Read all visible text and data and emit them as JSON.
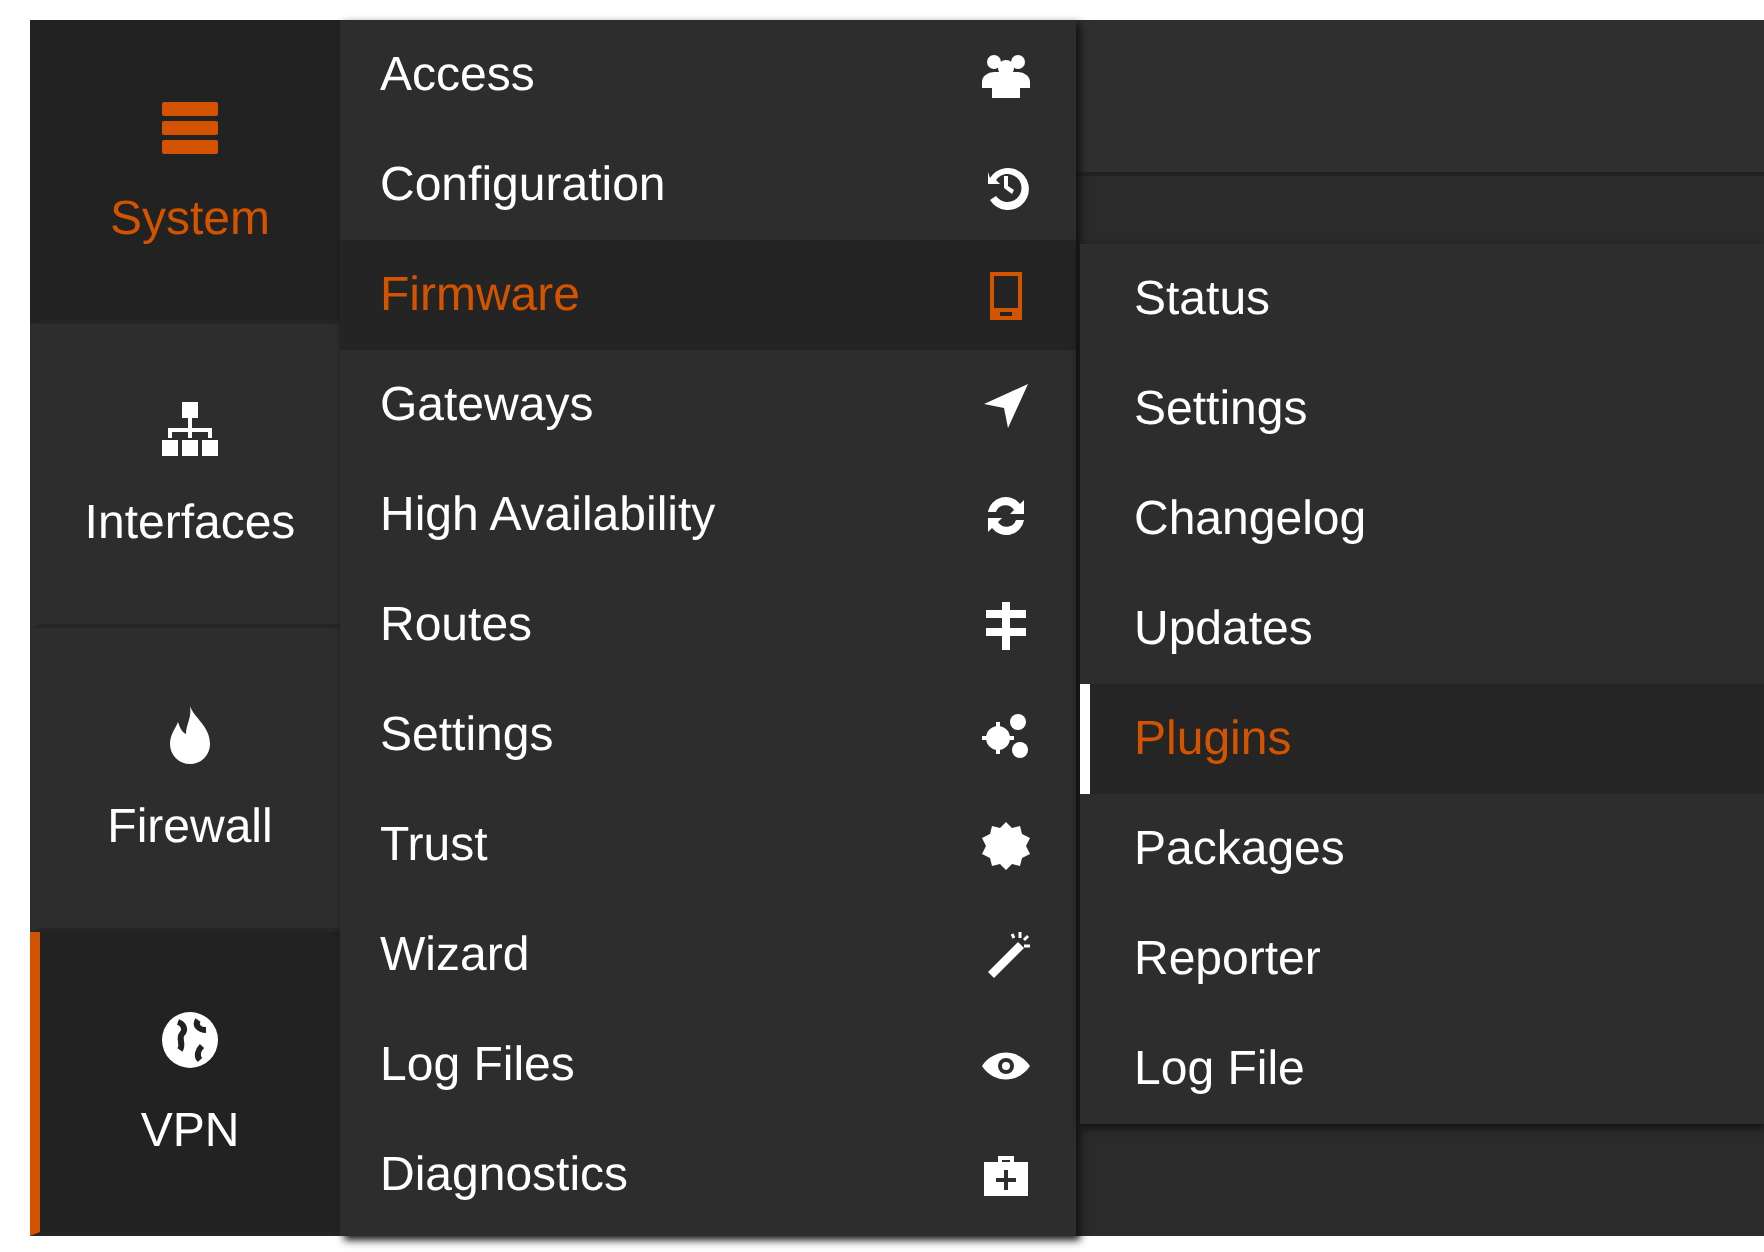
{
  "sidebar": {
    "items": [
      {
        "label": "System",
        "expanded": true,
        "active": false
      },
      {
        "label": "Interfaces",
        "expanded": false,
        "active": false
      },
      {
        "label": "Firewall",
        "expanded": false,
        "active": false
      },
      {
        "label": "VPN",
        "expanded": false,
        "active": true
      }
    ]
  },
  "menu": {
    "items": [
      {
        "label": "Access",
        "selected": false
      },
      {
        "label": "Configuration",
        "selected": false
      },
      {
        "label": "Firmware",
        "selected": true
      },
      {
        "label": "Gateways",
        "selected": false
      },
      {
        "label": "High Availability",
        "selected": false
      },
      {
        "label": "Routes",
        "selected": false
      },
      {
        "label": "Settings",
        "selected": false
      },
      {
        "label": "Trust",
        "selected": false
      },
      {
        "label": "Wizard",
        "selected": false
      },
      {
        "label": "Log Files",
        "selected": false
      },
      {
        "label": "Diagnostics",
        "selected": false
      }
    ]
  },
  "submenu": {
    "items": [
      {
        "label": "Status",
        "selected": false
      },
      {
        "label": "Settings",
        "selected": false
      },
      {
        "label": "Changelog",
        "selected": false
      },
      {
        "label": "Updates",
        "selected": false
      },
      {
        "label": "Plugins",
        "selected": true
      },
      {
        "label": "Packages",
        "selected": false
      },
      {
        "label": "Reporter",
        "selected": false
      },
      {
        "label": "Log File",
        "selected": false
      }
    ]
  }
}
